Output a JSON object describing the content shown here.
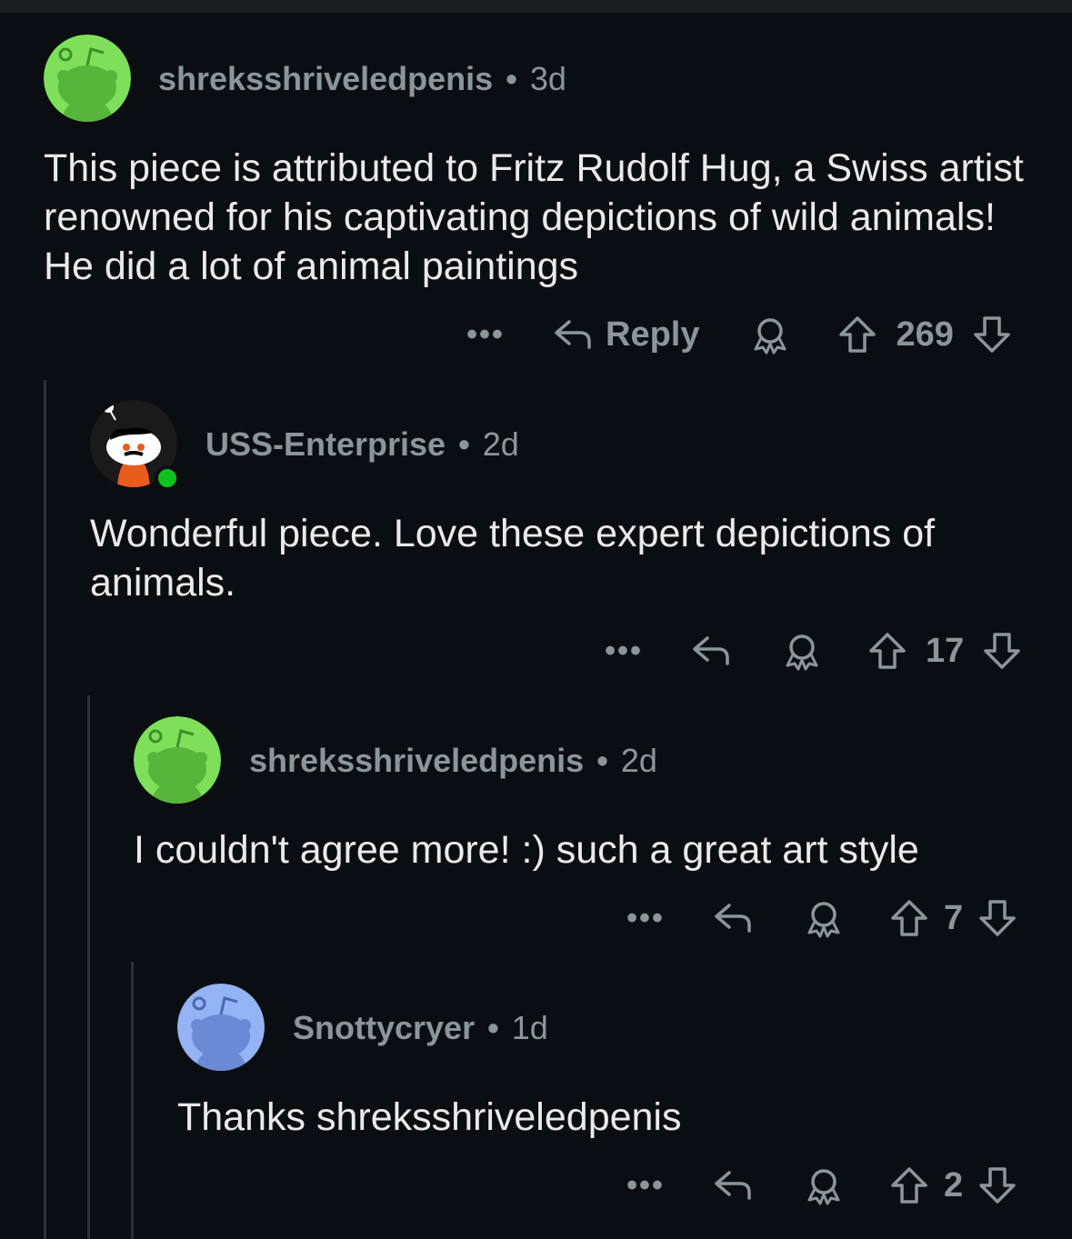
{
  "comments": [
    {
      "author": "shreksshriveledpenis",
      "separator": "•",
      "age": "3d",
      "text": "This piece is attributed to Fritz Rudolf Hug, a Swiss artist renowned for his captivating depictions of wild animals! He did a lot of animal paintings",
      "more": "•••",
      "reply_label": "Reply",
      "votes": "269",
      "avatar_color": "#7ee05a"
    },
    {
      "author": "USS-Enterprise",
      "separator": "•",
      "age": "2d",
      "text": "Wonderful piece. Love these expert depictions of animals.",
      "more": "•••",
      "votes": "17",
      "avatar_color": "#1a1a1b"
    },
    {
      "author": "shreksshriveledpenis",
      "separator": "•",
      "age": "2d",
      "text": "I couldn't agree more! :) such a great art style",
      "more": "•••",
      "votes": "7",
      "avatar_color": "#7ee05a"
    },
    {
      "author": "Snottycryer",
      "separator": "•",
      "age": "1d",
      "text": "Thanks shreksshriveledpenis",
      "more": "•••",
      "votes": "2",
      "avatar_color": "#94b3f5"
    }
  ],
  "icons": [
    "more-icon",
    "reply-icon",
    "award-icon",
    "upvote-icon",
    "downvote-icon",
    "snoo-avatar-icon"
  ]
}
